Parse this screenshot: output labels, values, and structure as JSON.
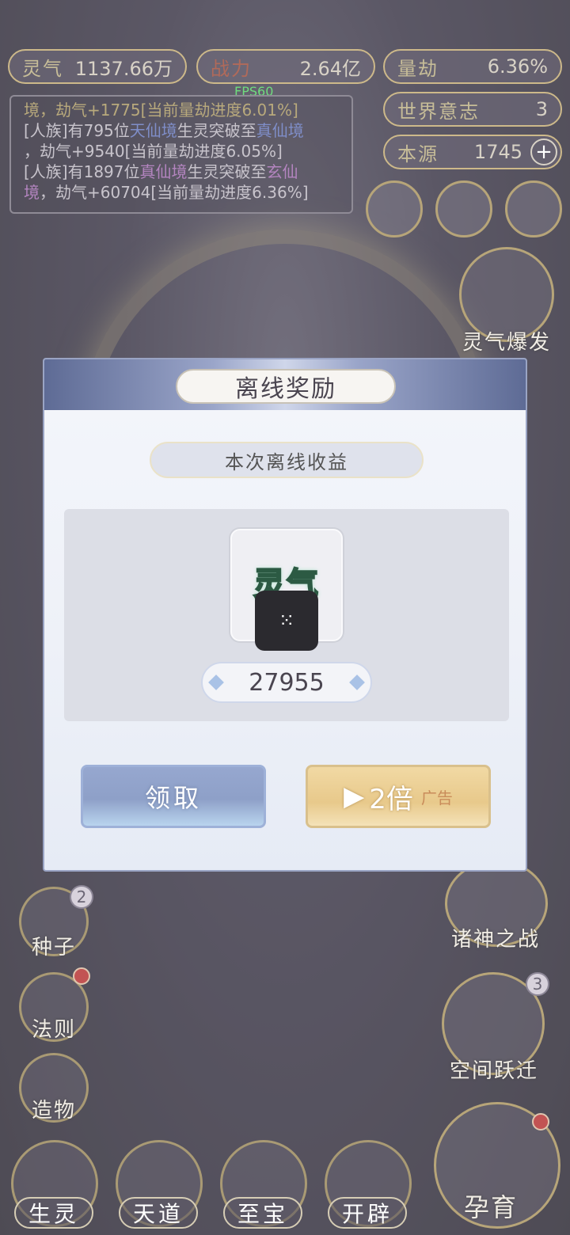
{
  "stats": {
    "lingqi": {
      "label": "灵气",
      "value": "1137.66万"
    },
    "zhanli": {
      "label": "战力",
      "value": "2.64亿"
    },
    "liangjie": {
      "label": "量劫",
      "value": "6.36%"
    },
    "shijie": {
      "label": "世界意志",
      "value": "3"
    },
    "benyuan": {
      "label": "本源",
      "value": "1745",
      "plus": "+"
    }
  },
  "fps": "FPS60",
  "log": {
    "line1_a": "境，劫气+1775[当前量劫进度6.01%]",
    "line2_a": "[人族]有795位",
    "line2_b": "天仙境",
    "line2_c": "生灵突破至",
    "line2_d": "真仙境",
    "line3": "，劫气+9540[当前量劫进度6.05%]",
    "line4_a": "[人族]有1897位",
    "line4_b": "真仙境",
    "line4_c": "生灵突破至",
    "line4_d": "玄仙",
    "line5_a": "境",
    "line5_b": "，劫气+60704[当前量劫进度6.36%]"
  },
  "left_side": {
    "seed": {
      "label": "种子",
      "badge": "2"
    },
    "law": {
      "label": "法则"
    },
    "creation": {
      "label": "造物"
    }
  },
  "right_side": {
    "burst": {
      "label": "灵气爆发"
    },
    "war": {
      "label": "诸神之战"
    },
    "jump": {
      "label": "空间跃迁",
      "badge": "3"
    },
    "nurture": {
      "label": "孕育"
    }
  },
  "bottom_nav": {
    "shengling": "生灵",
    "tiandao": "天道",
    "zhibao": "至宝",
    "kaipi": "开辟"
  },
  "dialog": {
    "title": "离线奖励",
    "subtitle": "本次离线收益",
    "item_name": "灵气",
    "loading_glyph": "⁙",
    "amount": "27955",
    "claim_label": "领取",
    "double_play": "▶",
    "double_label": "2倍",
    "double_ad": "广告"
  }
}
